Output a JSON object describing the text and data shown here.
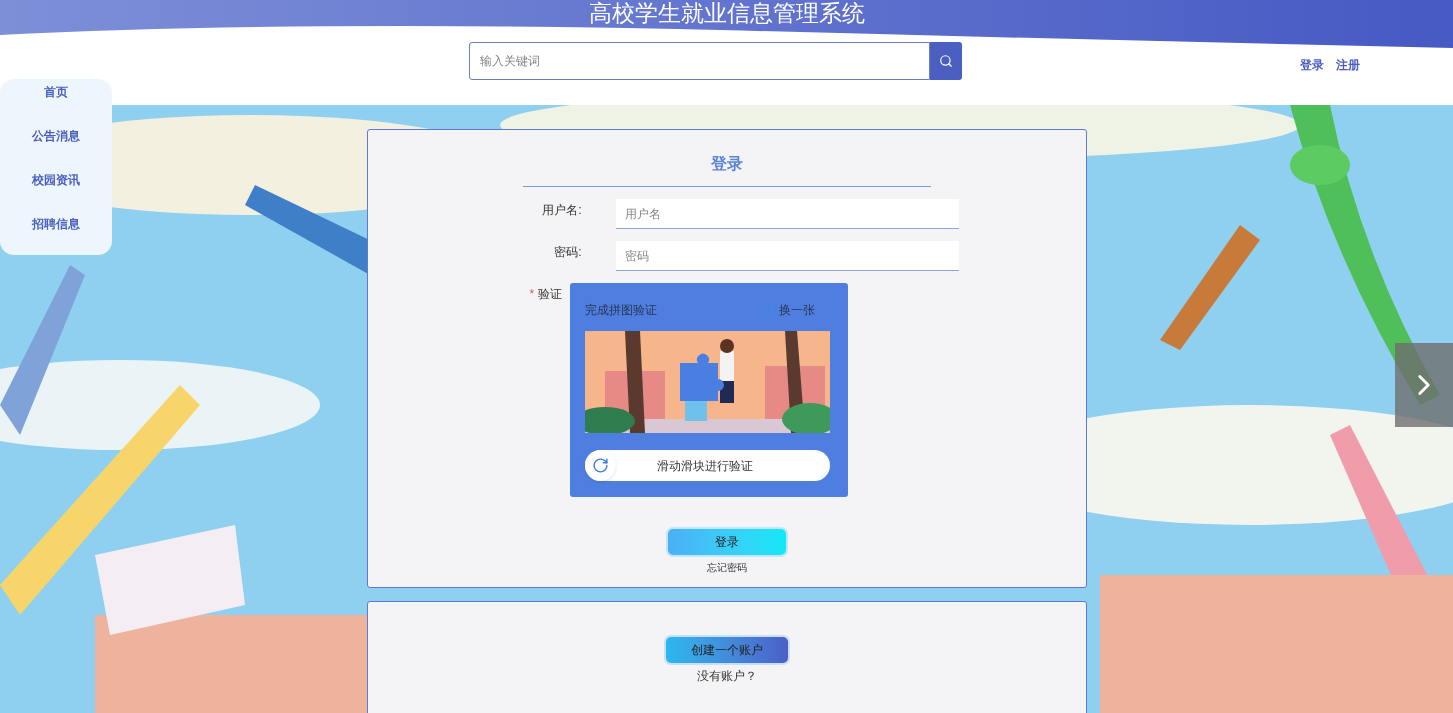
{
  "header": {
    "title": "高校学生就业信息管理系统",
    "search": {
      "placeholder": "输入关键词"
    },
    "links": [
      "登录",
      "注册"
    ]
  },
  "sidebar": {
    "items": [
      {
        "label": "首页"
      },
      {
        "label": "公告消息"
      },
      {
        "label": "校园资讯"
      },
      {
        "label": "招聘信息"
      }
    ]
  },
  "login_form": {
    "title": "登录",
    "fields": [
      {
        "label": "用户名:",
        "placeholder": "用户名"
      },
      {
        "label": "密码:",
        "placeholder": "密码"
      }
    ],
    "captcha": {
      "required_mark": "*",
      "label": "验证",
      "prompt": "完成拼图验证",
      "refresh": "换一张",
      "slider_text": "滑动滑块进行验证"
    },
    "submit": "登录",
    "forgot": "忘记密码"
  },
  "register": {
    "button": "创建一个账户",
    "hint": "没有账户？"
  }
}
